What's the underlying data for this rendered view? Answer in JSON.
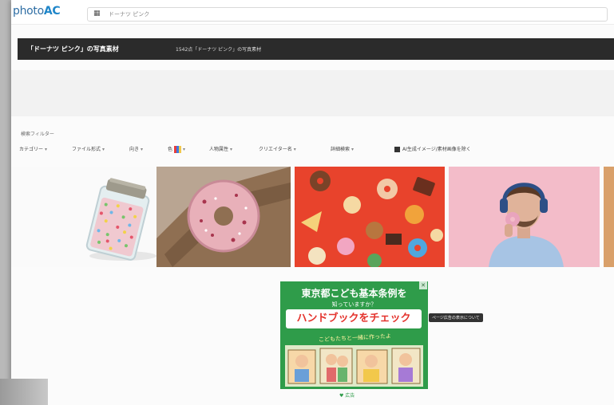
{
  "header": {
    "logo_text": "photo",
    "logo_accent": "AC",
    "search_value": "ドーナツ ピンク"
  },
  "titlebar": {
    "title": "「ドーナツ ピンク」の写真素材",
    "subtitle": "1542点「ドーナツ ピンク」の写真素材"
  },
  "filters": {
    "label": "検索フィルター",
    "items": [
      {
        "label": "カテゴリー"
      },
      {
        "label": "ファイル形式"
      },
      {
        "label": "向き"
      },
      {
        "label": "色"
      },
      {
        "label": "人物属性"
      },
      {
        "label": "クリエイター名"
      },
      {
        "label": "詳細検索"
      }
    ],
    "checkbox_label": "AI生成イメージ/素材画像を除く"
  },
  "photos": [
    {
      "name": "sprinkles-jar"
    },
    {
      "name": "pink-donut-on-board"
    },
    {
      "name": "sweets-on-red"
    },
    {
      "name": "man-with-headphones-eating"
    },
    {
      "name": "partial-photo"
    }
  ],
  "ad": {
    "line1": "東京都こども基本条例を",
    "line2": "知っていますか？",
    "line3": "ハンドブックをチェック",
    "line4": "こどもたちと一緒に作ったよ",
    "tooltip": "ページ広告の表示について",
    "info": "広告"
  },
  "colors": {
    "titlebar_bg": "#2b2b2b",
    "ad_green": "#2f9c4a",
    "logo_blue": "#2f6ea4"
  }
}
